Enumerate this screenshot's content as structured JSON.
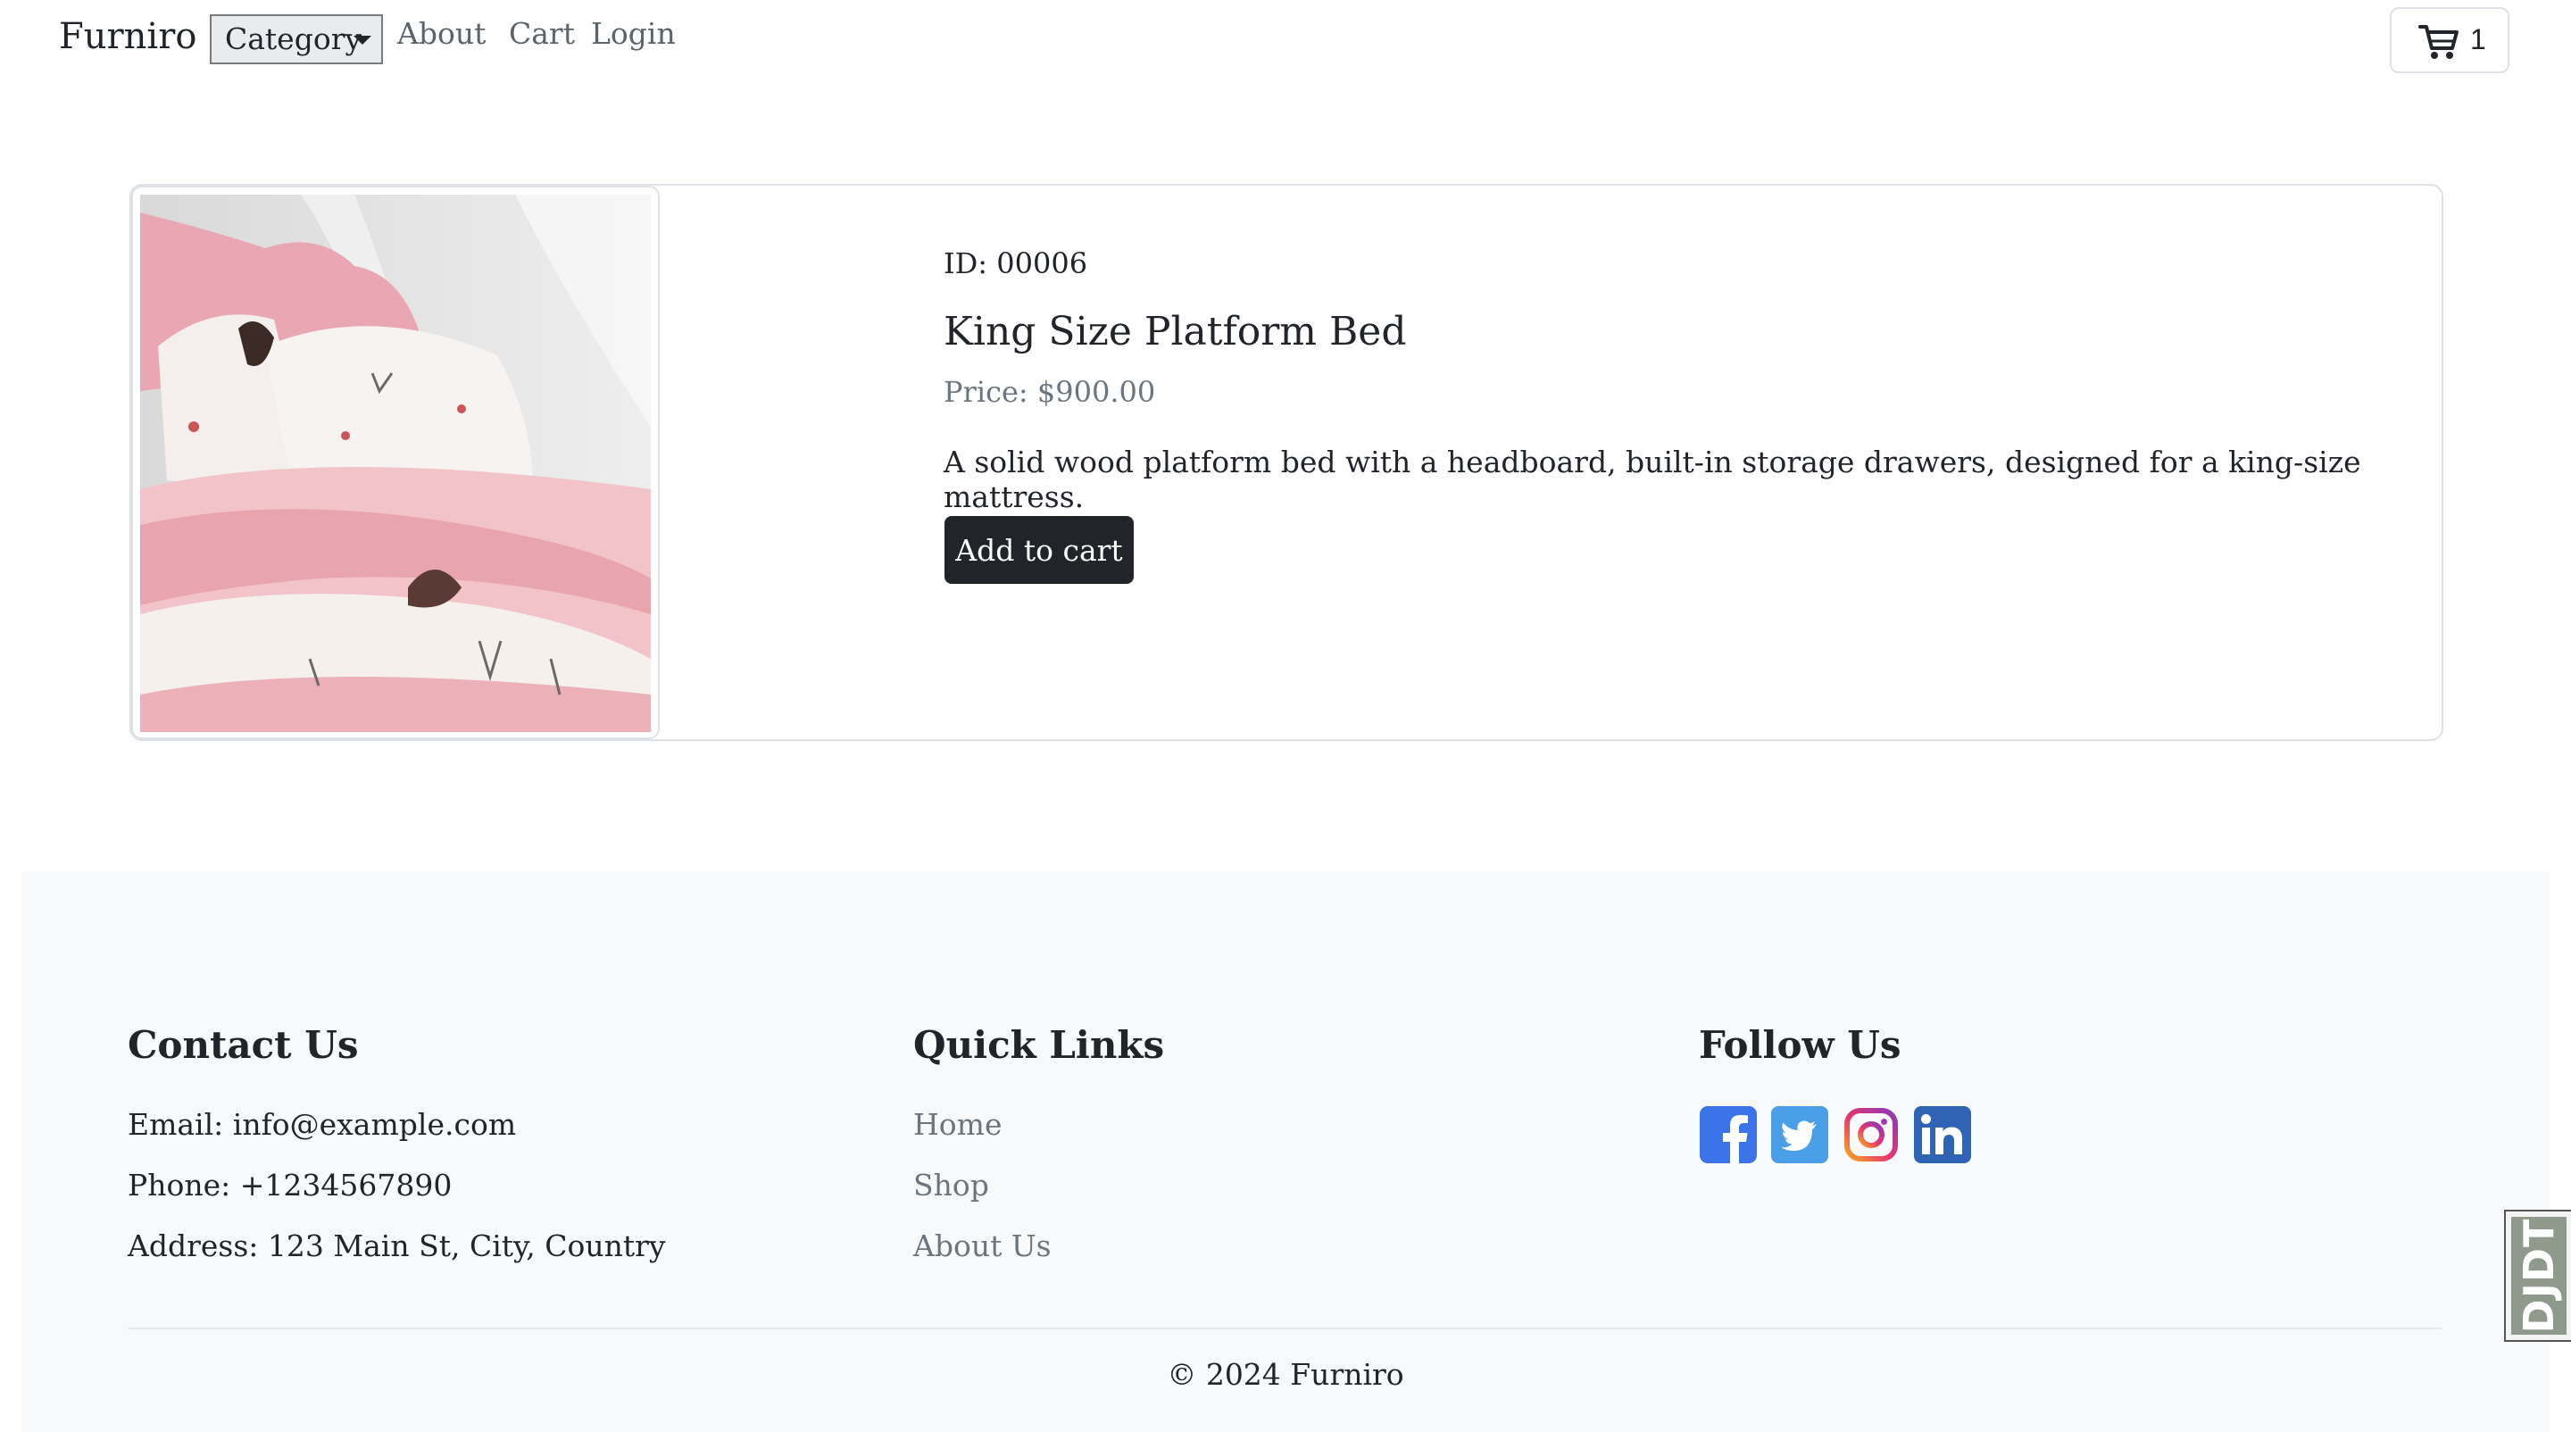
{
  "navbar": {
    "brand": "Furniro",
    "category_label": "Category",
    "links": [
      "About",
      "Cart",
      "Login"
    ],
    "cart_count": "1"
  },
  "product": {
    "id_text": "ID: 00006",
    "name": "King Size Platform Bed",
    "price_text": "Price: $900.00",
    "description": "A solid wood platform bed with a headboard, built-in storage drawers, designed for a king-size mattress.",
    "add_to_cart_label": "Add to cart"
  },
  "footer": {
    "contact": {
      "title": "Contact Us",
      "email": "Email: info@example.com",
      "phone": "Phone: +1234567890",
      "address": "Address: 123 Main St, City, Country"
    },
    "quick_links": {
      "title": "Quick Links",
      "links": [
        "Home",
        "Shop",
        "About Us"
      ]
    },
    "follow": {
      "title": "Follow Us",
      "icons": [
        "facebook-icon",
        "twitter-icon",
        "instagram-icon",
        "linkedin-icon"
      ]
    },
    "copyright": "© 2024 Furniro"
  },
  "debug_toolbar": {
    "label": "DJDT"
  },
  "colors": {
    "primary_dark": "#212529",
    "muted": "#6c757d",
    "footer_bg": "#f8f9fa",
    "facebook": "#3b73e8",
    "twitter": "#4a9fe8",
    "linkedin": "#2f64b5"
  }
}
